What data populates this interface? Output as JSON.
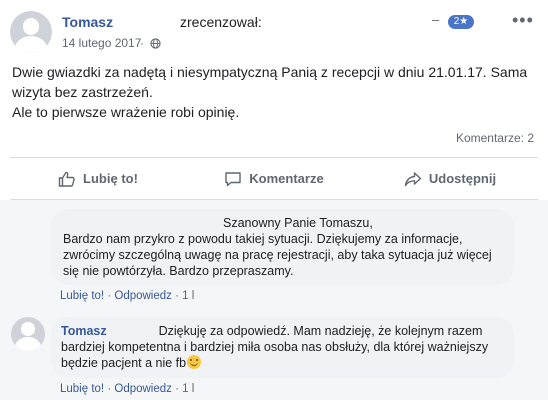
{
  "post": {
    "author": "Tomasz",
    "action": "zrecenzował:",
    "date": "14 lutego 2017",
    "date_sep": "·",
    "dash": "–",
    "badge": "2★",
    "more": "•••",
    "text_line1": "Dwie gwiazdki za nadętą i niesympatyczną Panią z recepcji w dniu 21.01.17. Sama wizyta bez zastrzeżeń.",
    "text_line2": "Ale to pierwsze wrażenie robi opinię.",
    "comment_count": "Komentarze: 2"
  },
  "actions": {
    "like": "Lubię to!",
    "comment": "Komentarze",
    "share": "Udostępnij"
  },
  "comments": [
    {
      "greeting": "Szanowny Panie Tomaszu,",
      "body": "Bardzo nam przykro z powodu takiej sytuacji. Dziękujemy za informacje, zwrócimy szczególną uwagę na pracę rejestracji, aby taka sytuacja już więcej się nie powtórzyła. Bardzo przepraszamy.",
      "like": "Lubię to!",
      "sep": "·",
      "reply": "Odpowiedz",
      "meta": "1 l"
    },
    {
      "author": "Tomasz",
      "body": "Dziękuję za odpowiedź. Mam nadzieję, że kolejnym razem bardziej kompetentna i bardziej miła osoba nas obsłuży, dla której ważniejszy będzie pacjent a nie fb",
      "like": "Lubię to!",
      "sep": "·",
      "reply": "Odpowiedz",
      "meta": "1 l"
    }
  ],
  "icons": {
    "globe": "globe-icon",
    "like": "thumbs-up-icon",
    "comment": "speech-bubble-icon",
    "share": "share-arrow-icon",
    "emoji": "smile-emoji-icon"
  },
  "colors": {
    "link": "#365899",
    "badge": "#4a76c9",
    "muted": "#606770"
  }
}
